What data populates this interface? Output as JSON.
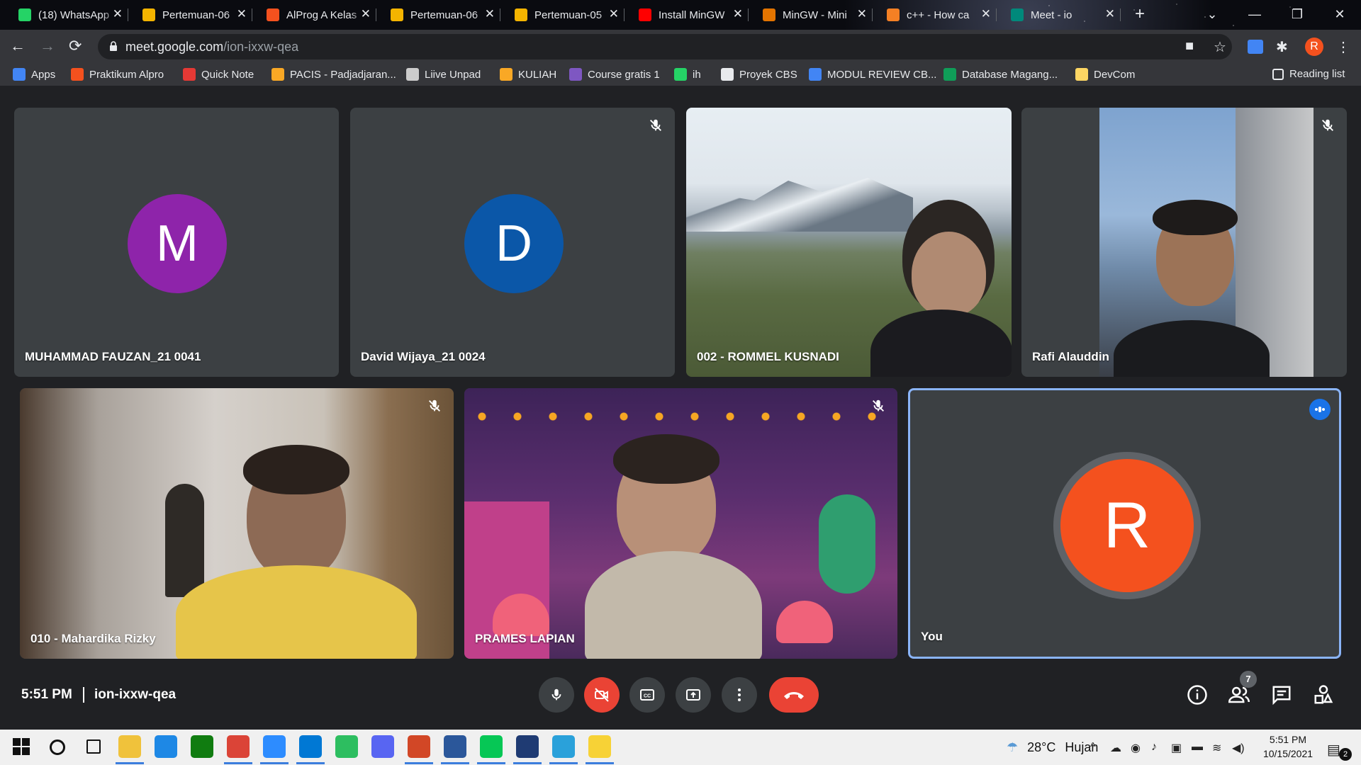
{
  "browser": {
    "tabs": [
      {
        "title": "(18) WhatsApp",
        "icon": "whatsapp-icon",
        "color": "#25d366"
      },
      {
        "title": "Pertemuan-06",
        "icon": "slides-icon",
        "color": "#f4b400"
      },
      {
        "title": "AlProg A Kelas",
        "icon": "classroom-icon",
        "color": "#f4511e"
      },
      {
        "title": "Pertemuan-06",
        "icon": "slides-icon",
        "color": "#f4b400"
      },
      {
        "title": "Pertemuan-05",
        "icon": "slides-icon",
        "color": "#f4b400"
      },
      {
        "title": "Install MinGW",
        "icon": "youtube-icon",
        "color": "#ff0000"
      },
      {
        "title": "MinGW - Mini",
        "icon": "mingw-icon",
        "color": "#e37400"
      },
      {
        "title": "c++ - How ca",
        "icon": "stackoverflow-icon",
        "color": "#f48024"
      },
      {
        "title": "Meet - io",
        "icon": "meet-icon",
        "color": "#00897b"
      }
    ],
    "url_host": "meet.google.com",
    "url_path": "/ion-ixxw-qea",
    "profile_initial": "R",
    "bookmarks": [
      {
        "label": "Apps",
        "icon": "apps-grid-icon",
        "color": "#4285f4"
      },
      {
        "label": "Praktikum Alpro",
        "icon": "classroom-icon",
        "color": "#f4511e"
      },
      {
        "label": "Quick Note",
        "icon": "pin-icon",
        "color": "#e53935"
      },
      {
        "label": "PACIS - Padjadjaran...",
        "icon": "unpad-icon",
        "color": "#f9a825"
      },
      {
        "label": "Liive Unpad",
        "icon": "live-icon",
        "color": "#cccccc"
      },
      {
        "label": "KULIAH",
        "icon": "unpad-icon",
        "color": "#f9a825"
      },
      {
        "label": "Course gratis 1",
        "icon": "info-icon",
        "color": "#7e57c2"
      },
      {
        "label": "ih",
        "icon": "whatsapp-icon",
        "color": "#25d366"
      },
      {
        "label": "Proyek CBS",
        "icon": "github-icon",
        "color": "#e8eaed"
      },
      {
        "label": "MODUL REVIEW CB...",
        "icon": "docs-icon",
        "color": "#4285f4"
      },
      {
        "label": "Database Magang...",
        "icon": "sheets-icon",
        "color": "#0f9d58"
      },
      {
        "label": "DevCom",
        "icon": "folder-icon",
        "color": "#fdd663"
      }
    ],
    "reading_list": "Reading list"
  },
  "meet": {
    "participants": [
      {
        "name": "MUHAMMAD FAUZAN_21 0041",
        "initial": "M",
        "avatar_color": "#8e24aa",
        "muted": false,
        "video": false
      },
      {
        "name": "David Wijaya_21 0024",
        "initial": "D",
        "avatar_color": "#0b57a8",
        "muted": true,
        "video": false
      },
      {
        "name": "002 - ROMMEL KUSNADI",
        "muted": false,
        "video": true
      },
      {
        "name": "Rafi Alauddin",
        "muted": true,
        "video": true
      },
      {
        "name": "010 - Mahardika Rizky",
        "muted": true,
        "video": true
      },
      {
        "name": "PRAMES LAPIAN",
        "muted": true,
        "video": true
      },
      {
        "name": "You",
        "initial": "R",
        "avatar_color": "#f4511e",
        "muted": false,
        "video": false
      }
    ],
    "time": "5:51 PM",
    "meeting_code": "ion-ixxw-qea",
    "people_count": "7",
    "colors": {
      "end_call": "#ea4335",
      "active_speaker": "#8ab4f8"
    }
  },
  "taskbar": {
    "apps": [
      "windows-start-icon",
      "search-icon",
      "task-view-icon",
      "file-explorer-icon",
      "mail-icon",
      "xbox-icon",
      "chrome-icon",
      "zoom-icon",
      "vscode-icon",
      "evernote-icon",
      "discord-icon",
      "powerpoint-icon",
      "word-icon",
      "line-icon",
      "devc-icon",
      "telegram-icon",
      "sticky-notes-icon"
    ],
    "weather_temp": "28°C",
    "weather_text": "Hujan",
    "time": "5:51 PM",
    "date": "10/15/2021",
    "notifications": "2"
  }
}
